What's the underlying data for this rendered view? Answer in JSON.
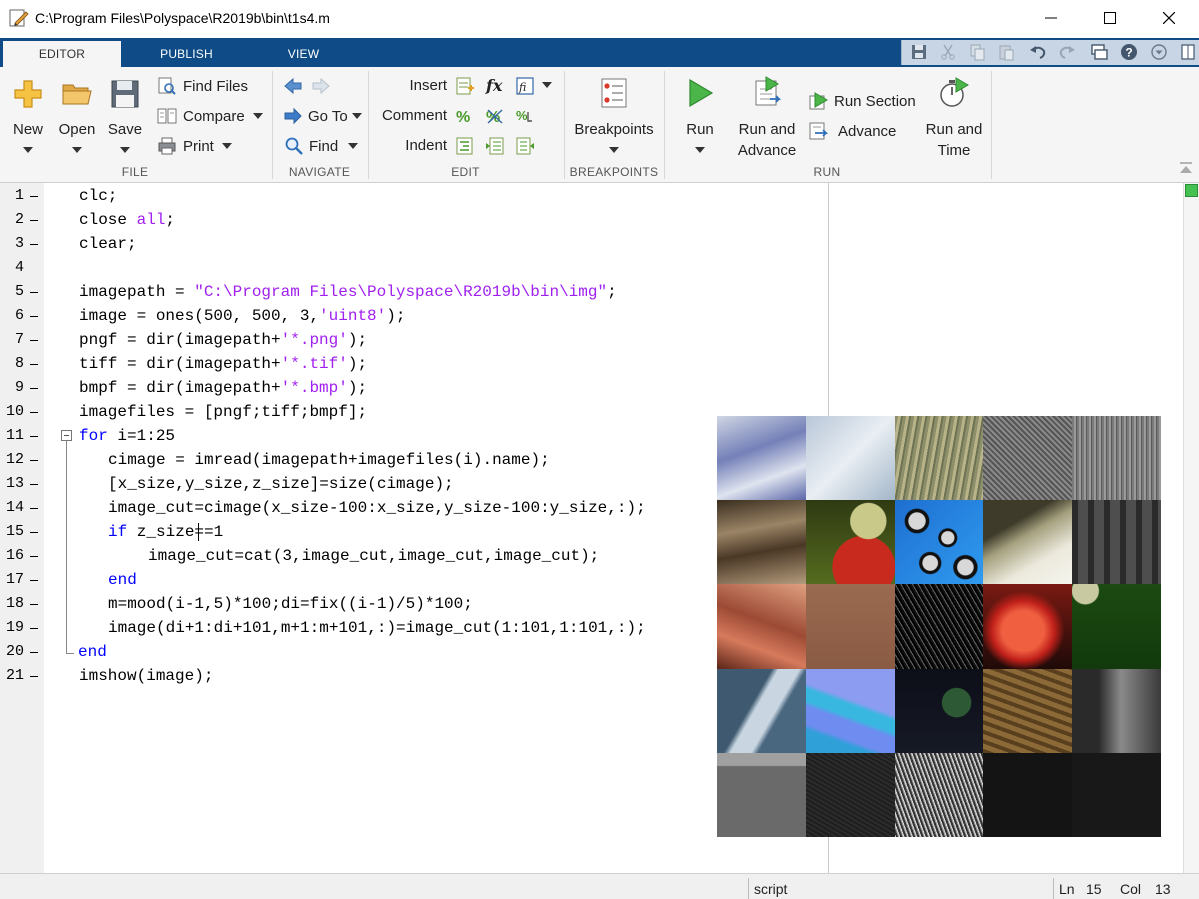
{
  "window": {
    "title": "C:\\Program Files\\Polyspace\\R2019b\\bin\\t1s4.m"
  },
  "tabs": [
    {
      "label": "EDITOR",
      "active": true
    },
    {
      "label": "PUBLISH",
      "active": false
    },
    {
      "label": "VIEW",
      "active": false
    }
  ],
  "ribbon": {
    "file": {
      "group_label": "FILE",
      "new_label": "New",
      "open_label": "Open",
      "save_label": "Save",
      "find_files_label": "Find Files",
      "compare_label": "Compare",
      "print_label": "Print"
    },
    "navigate": {
      "group_label": "NAVIGATE",
      "go_to_label": "Go To",
      "find_label": "Find"
    },
    "edit": {
      "group_label": "EDIT",
      "insert_label": "Insert",
      "comment_label": "Comment",
      "indent_label": "Indent"
    },
    "breakpoints": {
      "group_label": "BREAKPOINTS",
      "breakpoints_label": "Breakpoints"
    },
    "run": {
      "group_label": "RUN",
      "run_label": "Run",
      "run_and_advance_line1": "Run and",
      "run_and_advance_line2": "Advance",
      "run_section_label": "Run Section",
      "advance_label": "Advance",
      "run_and_time_line1": "Run and",
      "run_and_time_line2": "Time"
    }
  },
  "editor": {
    "line_numbers": [
      "1",
      "2",
      "3",
      "4",
      "5",
      "6",
      "7",
      "8",
      "9",
      "10",
      "11",
      "12",
      "13",
      "14",
      "15",
      "16",
      "17",
      "18",
      "19",
      "20",
      "21"
    ],
    "code": {
      "l1": "clc;",
      "l2a": "close ",
      "l2b": "all",
      "l2c": ";",
      "l3": "clear;",
      "l5a": "imagepath = ",
      "l5b": "\"C:\\Program Files\\Polyspace\\R2019b\\bin\\img\"",
      "l5c": ";",
      "l6a": "image = ones(500, 500, 3,",
      "l6b": "'uint8'",
      "l6c": ");",
      "l7a": "pngf = dir(imagepath+",
      "l7b": "'*.png'",
      "l7c": ");",
      "l8a": "tiff = dir(imagepath+",
      "l8b": "'*.tif'",
      "l8c": ");",
      "l9a": "bmpf = dir(imagepath+",
      "l9b": "'*.bmp'",
      "l9c": ");",
      "l10": "imagefiles = [pngf;tiff;bmpf];",
      "l11a": "for",
      "l11b": " i=1:25",
      "l12": "cimage = imread(imagepath+imagefiles(i).name);",
      "l13": "[x_size,y_size,z_size]=size(cimage);",
      "l14": "image_cut=cimage(x_size-100:x_size,y_size-100:y_size,:);",
      "l15a": "if",
      "l15b": " z_size==1",
      "l16": "image_cut=cat(3,image_cut,image_cut,image_cut);",
      "l17": "end",
      "l18": "m=mood(i-1,5)*100;di=fix((i-1)/5)*100;",
      "l19": "image(di+1:di+101,m+1:m+101,:)=image_cut(1:101,1:101,:);",
      "l20": "end",
      "l21": "imshow(image);"
    }
  },
  "status": {
    "file_type": "script",
    "ln_label": "Ln",
    "ln_value": "15",
    "col_label": "Col",
    "col_value": "13"
  }
}
